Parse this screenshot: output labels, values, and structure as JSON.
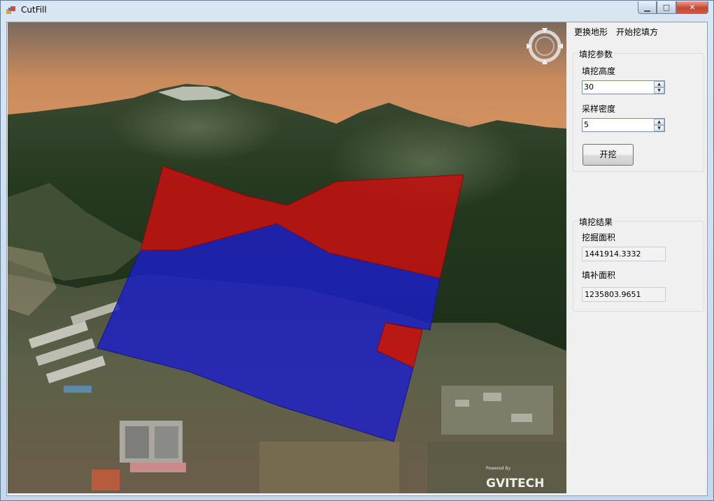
{
  "window": {
    "title": "CutFill"
  },
  "controls": {
    "minimize": "▁",
    "maximize": "□",
    "close": "✕"
  },
  "menu": {
    "change_terrain": "更换地形",
    "start_cutfill": "开始挖填方"
  },
  "params": {
    "group_title": "填挖参数",
    "height_label": "填挖高度",
    "height_value": "30",
    "density_label": "采样密度",
    "density_value": "5",
    "run_button": "开挖"
  },
  "results": {
    "group_title": "填挖结果",
    "cut_area_label": "挖掘面积",
    "cut_area_value": "1441914.3332",
    "fill_area_label": "填补面积",
    "fill_area_value": "1235803.9651"
  },
  "viewport": {
    "watermark_small": "Powered By",
    "watermark_brand": "GVITECH",
    "cut_color": "#c80f0f",
    "fill_color": "#1c1ec8"
  }
}
